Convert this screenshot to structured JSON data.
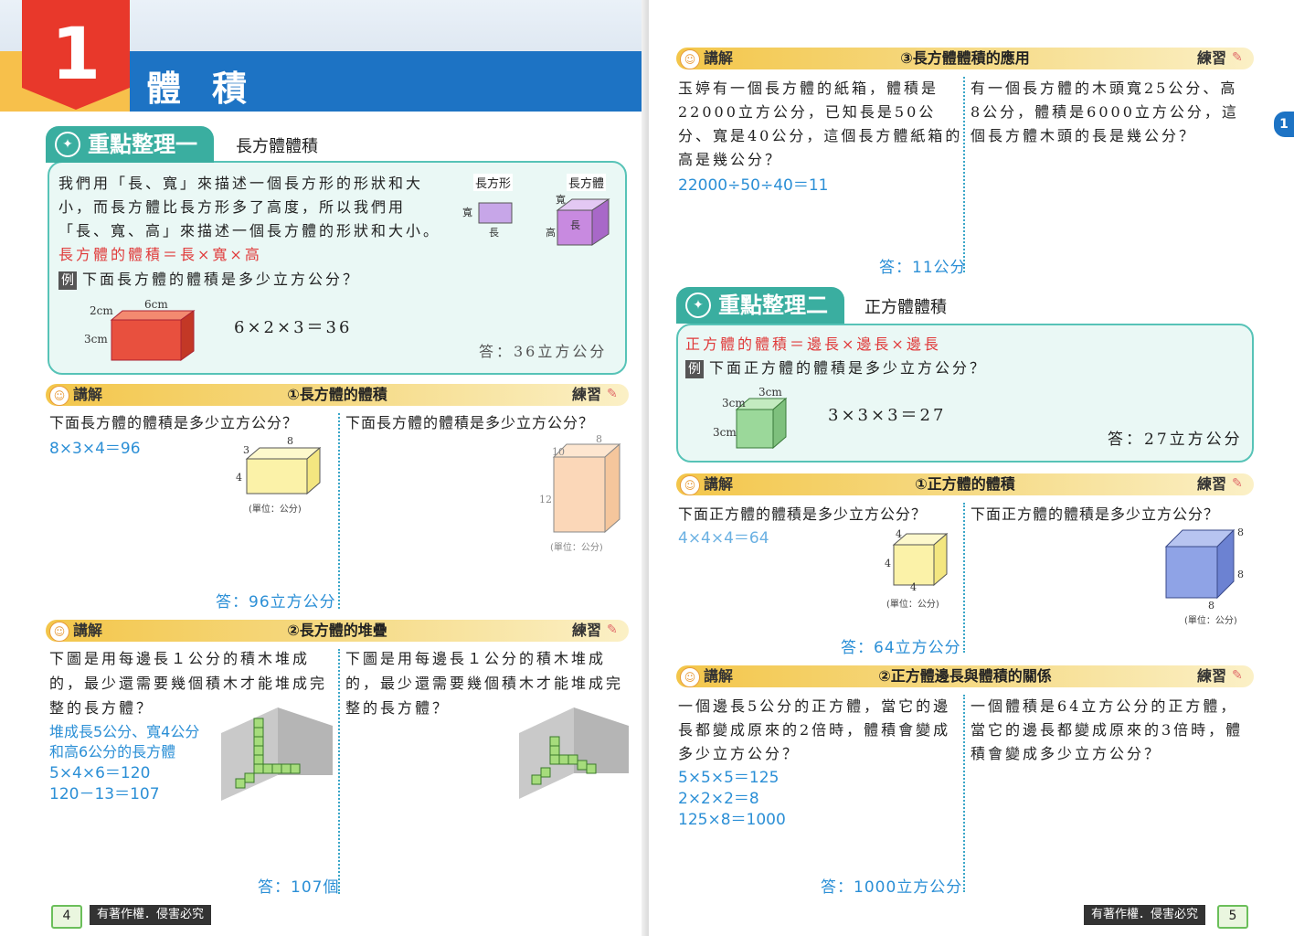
{
  "chapter": {
    "number": "1",
    "title": "體積"
  },
  "left": {
    "key1": {
      "tab": "重點整理一",
      "subtitle": "長方體體積",
      "para": [
        "我們用「長、寬」來描述一個長方形的形狀和大",
        "小，而長方體比長方形多了高度，所以我們用",
        "「長、寬、高」來描述一個長方體的形狀和大小。"
      ],
      "formula": "長方體的體積＝長×寬×高",
      "example_tag": "例",
      "example_q": "下面長方體的體積是多少立方公分？",
      "rect_label": "長方形",
      "box_label": "長方體",
      "rect_w": "寬",
      "rect_l": "長",
      "box_w": "寬",
      "box_l": "長",
      "box_h": "高",
      "dims": {
        "a": "2cm",
        "b": "6cm",
        "c": "3cm"
      },
      "calc": "6×2×3＝36",
      "answer": "答：36立方公分"
    },
    "sec1": {
      "tag": "講解",
      "title": "①長方體的體積",
      "practice": "練習",
      "q_left": "下面長方體的體積是多少立方公分？",
      "calc_left": "8×3×4＝96",
      "dims_left": {
        "top": "8",
        "side": "3",
        "h": "4"
      },
      "unit": "(單位：公分)",
      "answer_left": "答：96立方公分",
      "q_right": "下面長方體的體積是多少立方公分？",
      "dims_right": {
        "top": "8",
        "side": "10",
        "h": "12"
      }
    },
    "sec2": {
      "tag": "講解",
      "title": "②長方體的堆疊",
      "practice": "練習",
      "q_left": [
        "下圖是用每邊長１公分的積木堆成",
        "的，最少還需要幾個積木才能堆成完",
        "整的長方體？"
      ],
      "work": [
        "堆成長5公分、寬4公分",
        "和高6公分的長方體",
        "5×4×6＝120",
        "120－13＝107"
      ],
      "answer_left": "答：107個",
      "q_right": [
        "下圖是用每邊長１公分的積木堆成",
        "的，最少還需要幾個積木才能堆成完",
        "整的長方體？"
      ]
    },
    "footer": {
      "page": "4",
      "copyright": "有著作權．侵害必究"
    }
  },
  "right": {
    "sec3": {
      "tag": "講解",
      "title": "③長方體體積的應用",
      "practice": "練習",
      "q_left": [
        "玉婷有一個長方體的紙箱，體積是",
        "22000立方公分，已知長是50公",
        "分、寬是40公分，這個長方體紙箱的",
        "高是幾公分？"
      ],
      "calc_left": "22000÷50÷40＝11",
      "answer_left": "答：11公分",
      "q_right": [
        "有一個長方體的木頭寬25公分、高",
        "8公分，體積是6000立方公分，這",
        "個長方體木頭的長是幾公分？"
      ]
    },
    "key2": {
      "tab": "重點整理二",
      "subtitle": "正方體體積",
      "formula": "正方體的體積＝邊長×邊長×邊長",
      "example_tag": "例",
      "example_q": "下面正方體的體積是多少立方公分？",
      "dims": {
        "a": "3cm",
        "b": "3cm",
        "c": "3cm"
      },
      "calc": "3×3×3＝27",
      "answer": "答：27立方公分"
    },
    "sec4": {
      "tag": "講解",
      "title": "①正方體的體積",
      "practice": "練習",
      "q_left": "下面正方體的體積是多少立方公分？",
      "calc_left": "4×4×4＝64",
      "dims_left": {
        "a": "4",
        "b": "4",
        "c": "4"
      },
      "unit": "(單位：公分)",
      "answer_left": "答：64立方公分",
      "q_right": "下面正方體的體積是多少立方公分？",
      "dims_right": {
        "a": "8",
        "b": "8",
        "c": "8"
      }
    },
    "sec5": {
      "tag": "講解",
      "title": "②正方體邊長與體積的關係",
      "practice": "練習",
      "q_left": [
        "一個邊長5公分的正方體，當它的邊",
        "長都變成原來的2倍時，體積會變成",
        "多少立方公分？"
      ],
      "work": [
        "5×5×5＝125",
        "2×2×2＝8",
        "125×8＝1000"
      ],
      "answer_left": "答：1000立方公分",
      "q_right": [
        "一個體積是64立方公分的正方體，",
        "當它的邊長都變成原來的3倍時，體",
        "積會變成多少立方公分？"
      ]
    },
    "side_tab": "1",
    "footer": {
      "page": "5",
      "copyright": "有著作權．侵害必究"
    }
  }
}
